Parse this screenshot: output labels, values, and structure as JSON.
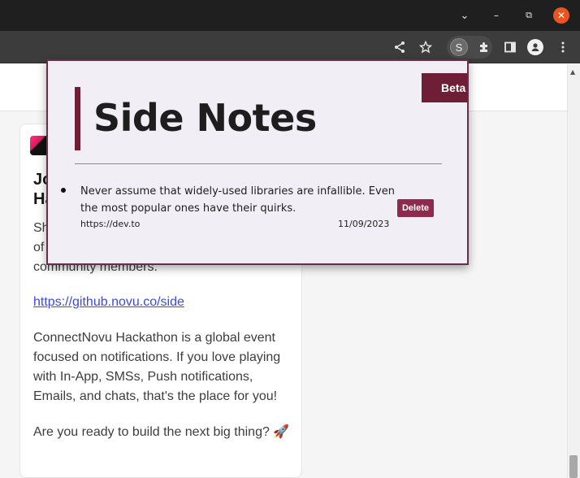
{
  "window": {
    "controls": {
      "minimize": "–",
      "maximize": "⧉",
      "close": "✕",
      "tabs_menu": "⌄"
    }
  },
  "toolbar": {
    "extension_letter": "S",
    "icons": [
      "share-icon",
      "star-icon",
      "puzzle-icon",
      "side-panel-icon",
      "profile-icon",
      "kebab-menu-icon"
    ]
  },
  "page": {
    "card": {
      "title_partial": [
        "Jo",
        "Ha"
      ],
      "paragraph1_partial": [
        "Sh",
        "of",
        "community members."
      ],
      "link": "https://github.novu.co/side",
      "paragraph2": "ConnectNovu Hackathon is a global event focused on notifications. If you love playing with In-App, SMSs, Push notifications, Emails, and chats, that's the place for you!",
      "paragraph3": "Are you ready to build the next big thing? 🚀"
    }
  },
  "popup": {
    "badge": "Beta",
    "title": "Side Notes",
    "notes": [
      {
        "text": "Never assume that widely-used libraries are infallible. Even the most popular ones have their quirks.",
        "url": "https://dev.to",
        "date": "11/09/2023",
        "delete_label": "Delete"
      }
    ],
    "accent_color": "#6e1e37"
  }
}
